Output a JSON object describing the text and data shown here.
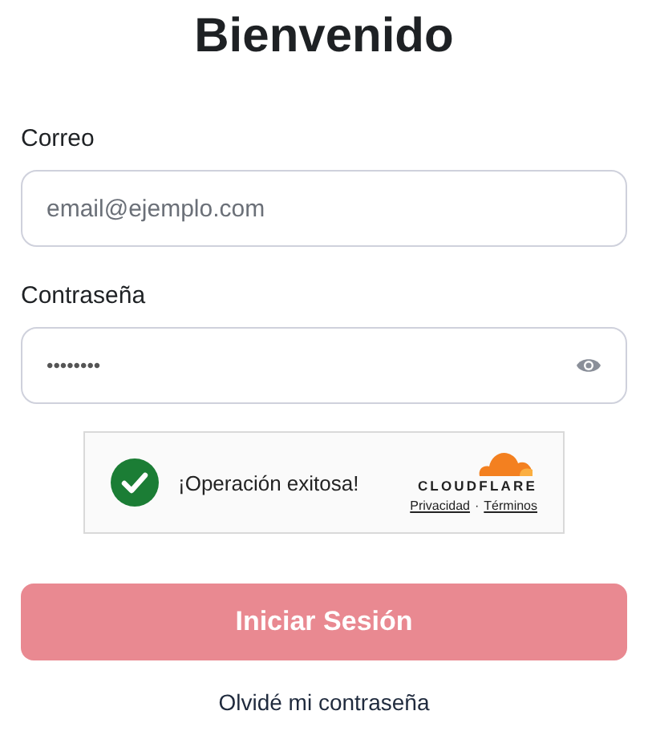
{
  "title": "Bienvenido",
  "email": {
    "label": "Correo",
    "placeholder": "email@ejemplo.com"
  },
  "password": {
    "label": "Contraseña",
    "value": "••••••••"
  },
  "captcha": {
    "status": "¡Operación exitosa!",
    "verified": true,
    "brand": "CLOUDFLARE",
    "links": [
      "Privacidad",
      "Términos"
    ],
    "separator": "·"
  },
  "submit": {
    "label": "Iniciar Sesión",
    "disabled": true
  },
  "forgot_link": "Olvidé mi contraseña"
}
